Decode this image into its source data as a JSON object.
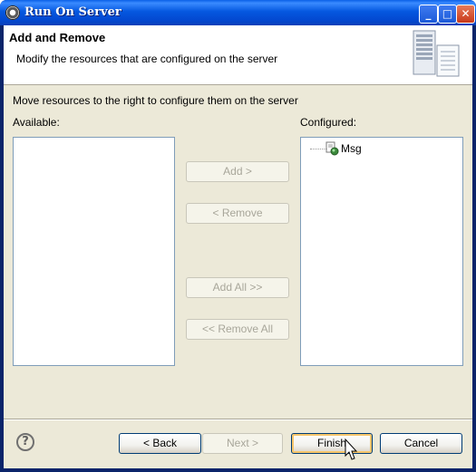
{
  "window": {
    "title": "Run On Server",
    "controls": {
      "minimize": "_",
      "maximize": "□",
      "close": "✕"
    }
  },
  "banner": {
    "title": "Add and Remove",
    "description": "Modify the resources that are configured on the server",
    "icon": "server-icon"
  },
  "instruction": "Move resources to the right to configure them on the server",
  "available": {
    "label": "Available:",
    "items": []
  },
  "configured": {
    "label": "Configured:",
    "items": [
      {
        "label": "Msg",
        "icon": "web-module-icon"
      }
    ]
  },
  "buttons": {
    "add": "Add >",
    "remove": "< Remove",
    "add_all": "Add All >>",
    "remove_all": "<< Remove All",
    "back": "< Back",
    "next": "Next >",
    "finish": "Finish",
    "cancel": "Cancel"
  },
  "help": {
    "glyph": "?"
  },
  "colors": {
    "title_bar": "#0558E0",
    "dialog_bg": "#ECE9D8",
    "list_border": "#7f9db9",
    "focus_highlight": "#f7c66b"
  }
}
